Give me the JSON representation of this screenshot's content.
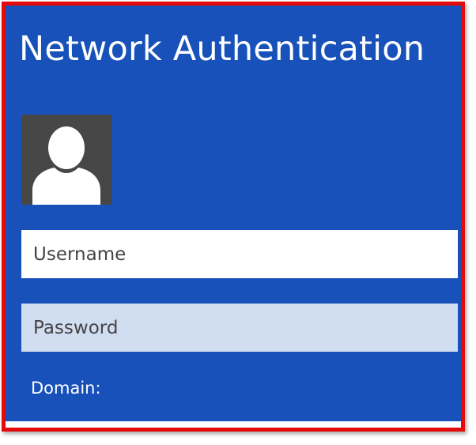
{
  "dialog": {
    "title": "Network Authentication",
    "avatar_icon": "user-silhouette-icon"
  },
  "form": {
    "username": {
      "value": "",
      "placeholder": "Username"
    },
    "password": {
      "value": "",
      "placeholder": "Password"
    },
    "domain_label": "Domain:"
  },
  "colors": {
    "panel_background": "#1751b9",
    "frame_border": "#e40a0a",
    "avatar_background": "#474747",
    "password_field_background": "#d1ddf0"
  }
}
